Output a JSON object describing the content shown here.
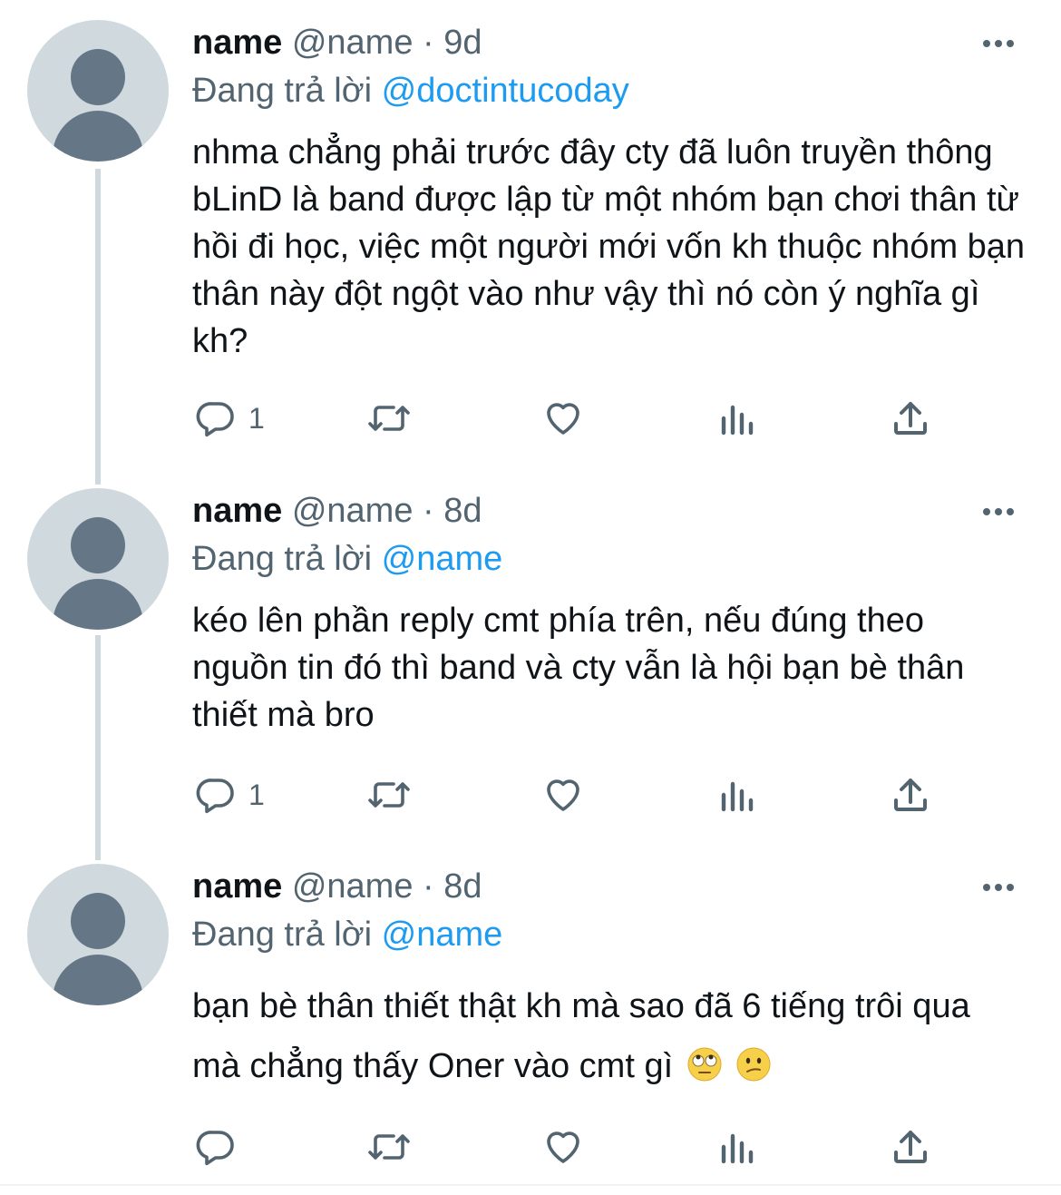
{
  "tweets": [
    {
      "name": "name",
      "handle": "@name",
      "time": "9d",
      "replying_label": "Đang trả lời",
      "replying_to": "@doctintucoday",
      "text": "nhma chẳng phải trước đây cty đã luôn truyền thông bLinD là band được lập từ một nhóm bạn chơi thân từ hồi đi học, việc một người mới vốn kh thuộc nhóm bạn thân này đột ngột vào như vậy thì nó còn ý nghĩa gì kh?",
      "reply_count": "1"
    },
    {
      "name": "name",
      "handle": "@name",
      "time": "8d",
      "replying_label": "Đang trả lời",
      "replying_to": "@name",
      "text": "kéo lên phần reply cmt phía trên, nếu đúng theo nguồn tin đó thì band và cty vẫn là hội bạn bè thân thiết mà bro",
      "reply_count": "1"
    },
    {
      "name": "name",
      "handle": "@name",
      "time": "8d",
      "replying_label": "Đang trả lời",
      "replying_to": "@name",
      "text": "bạn bè thân thiết thật kh mà sao đã 6 tiếng trôi qua mà chẳng thấy Oner vào cmt gì",
      "emojis": [
        "face-with-rolling-eyes",
        "confused-face"
      ],
      "reply_count": ""
    }
  ],
  "colors": {
    "text": "#0f1419",
    "secondary": "#536471",
    "link": "#1d9bf0",
    "avatar_bg": "#cfd9de",
    "avatar_fg": "#657786",
    "thread_line": "#cfd9de"
  },
  "icons": {
    "reply": "reply-icon",
    "retweet": "retweet-icon",
    "like": "like-icon",
    "views": "views-icon",
    "share": "share-icon",
    "more": "more-icon"
  }
}
